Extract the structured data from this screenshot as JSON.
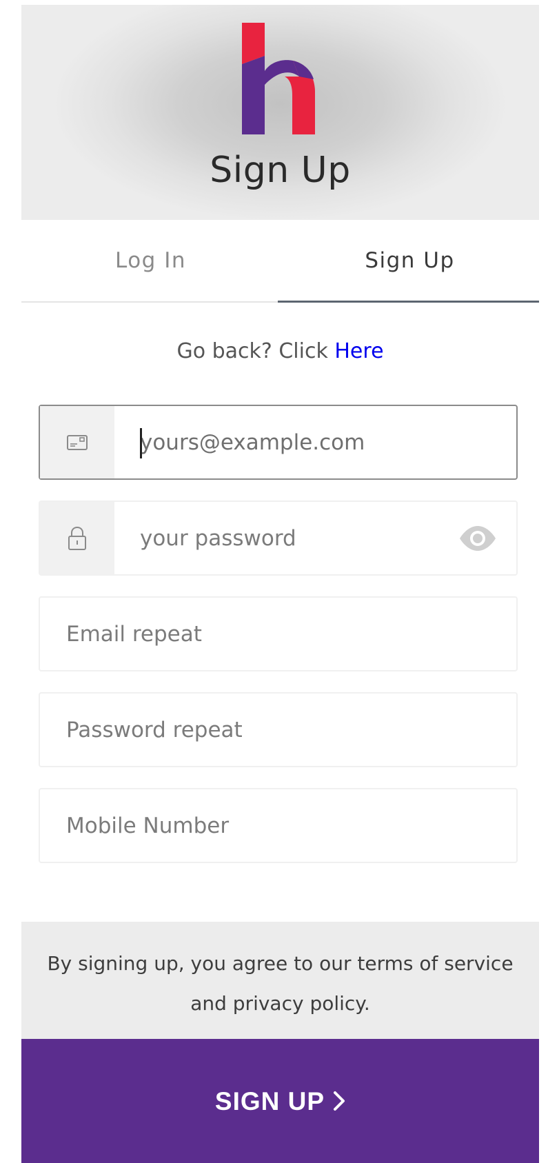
{
  "brand": {
    "logo_icon": "h-logo-icon",
    "logo_purple": "#5b2d8e",
    "logo_red": "#e8233f"
  },
  "header": {
    "title": "Sign Up"
  },
  "tabs": [
    {
      "label": "Log In",
      "active": false
    },
    {
      "label": "Sign Up",
      "active": true
    }
  ],
  "goback": {
    "prefix": "Go back? Click",
    "link": "Here"
  },
  "form": {
    "email": {
      "placeholder": "yours@example.com",
      "value": "",
      "icon": "envelope-icon"
    },
    "password": {
      "placeholder": "your password",
      "value": "",
      "icon": "lock-icon",
      "toggle_icon": "eye-icon"
    },
    "email_repeat": {
      "placeholder": "Email repeat",
      "value": ""
    },
    "password_repeat": {
      "placeholder": "Password repeat",
      "value": ""
    },
    "mobile": {
      "placeholder": "Mobile Number",
      "value": ""
    }
  },
  "terms": {
    "text": "By signing up, you agree to our terms of service and privacy policy."
  },
  "submit": {
    "label": "SIGN UP",
    "icon": "chevron-right-icon",
    "color": "#5b2d8e"
  }
}
